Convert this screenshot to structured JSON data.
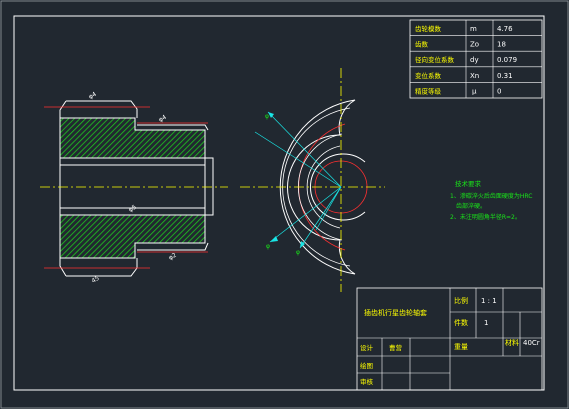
{
  "params_table": {
    "rows": [
      {
        "name": "齿轮模数",
        "symbol": "m",
        "value": "4.76"
      },
      {
        "name": "齿数",
        "symbol": "Zo",
        "value": "18"
      },
      {
        "name": "径向变位系数",
        "symbol": "dy",
        "value": "0.079"
      },
      {
        "name": "变位系数",
        "symbol": "Xn",
        "value": "0.31"
      },
      {
        "name": "精度等级",
        "symbol": "μ",
        "value": "0"
      }
    ]
  },
  "tech_req": {
    "title": "技术要求",
    "lines": [
      "1、渗碳淬火后齿面硬度为HRC",
      "齿部淬硬。",
      "2、未注明圆角半径R=2。"
    ]
  },
  "title_block": {
    "part_name": "插齿机行星齿轮轴套",
    "scale_label": "比例",
    "scale_value": "1 : 1",
    "qty_label": "件数",
    "qty_value": "1",
    "weight_label": "重量",
    "material_label": "材料",
    "material_value": "40Cr",
    "designer_label": "设计",
    "designer_value": "曹营",
    "drawer_label": "绘图",
    "reviewer_label": "审核"
  },
  "dimensions": {
    "d1": "φ4",
    "d2": "φ4",
    "d3": "φ5",
    "d4": "φ2",
    "d5": "45",
    "a1": "φ",
    "a2": "φ",
    "a3": "φ"
  },
  "colors": {
    "background": "#212830",
    "border": "#ffffff",
    "hatch": "#1ec81e",
    "center_line": "#ffff00",
    "dim_line": "#19e6e6",
    "hidden_red": "#ff3030"
  }
}
